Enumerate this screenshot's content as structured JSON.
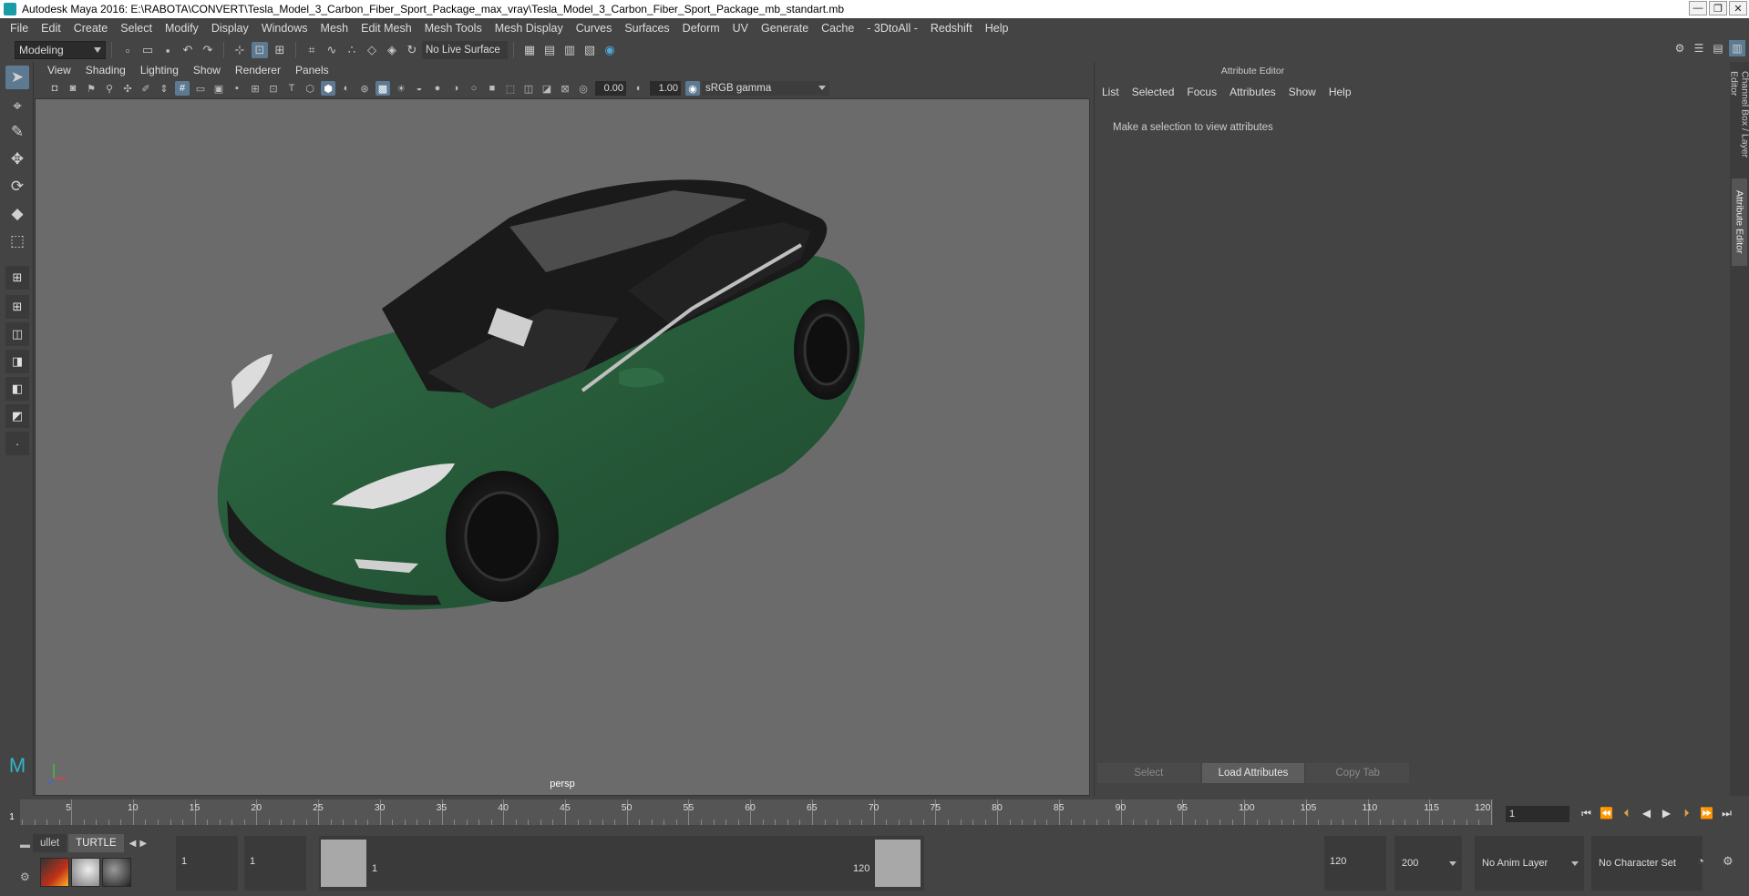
{
  "window": {
    "title": "Autodesk Maya 2016: E:\\RABOTA\\CONVERT\\Tesla_Model_3_Carbon_Fiber_Sport_Package_max_vray\\Tesla_Model_3_Carbon_Fiber_Sport_Package_mb_standart.mb",
    "minimize": "—",
    "restore": "❐",
    "close": "✕"
  },
  "menubar": [
    "File",
    "Edit",
    "Create",
    "Select",
    "Modify",
    "Display",
    "Windows",
    "Mesh",
    "Edit Mesh",
    "Mesh Tools",
    "Mesh Display",
    "Curves",
    "Surfaces",
    "Deform",
    "UV",
    "Generate",
    "Cache",
    "- 3DtoAll -",
    "Redshift",
    "Help"
  ],
  "statusline": {
    "mode": "Modeling",
    "live_surface": "No Live Surface"
  },
  "viewport": {
    "menu": [
      "View",
      "Shading",
      "Lighting",
      "Show",
      "Renderer",
      "Panels"
    ],
    "exposure": "0.00",
    "gamma": "1.00",
    "color_space": "sRGB gamma",
    "camera_label": "persp"
  },
  "attribute_editor": {
    "title": "Attribute Editor",
    "menu": [
      "List",
      "Selected",
      "Focus",
      "Attributes",
      "Show",
      "Help"
    ],
    "message": "Make a selection to view attributes",
    "buttons": {
      "select": "Select",
      "load": "Load Attributes",
      "copy": "Copy Tab"
    }
  },
  "side_tabs": {
    "channel_box": "Channel Box / Layer Editor",
    "attribute_editor": "Attribute Editor"
  },
  "timeslider": {
    "ticks": [
      "5",
      "10",
      "15",
      "20",
      "25",
      "30",
      "35",
      "40",
      "45",
      "50",
      "55",
      "60",
      "65",
      "70",
      "75",
      "80",
      "85",
      "90",
      "95",
      "100",
      "105",
      "110",
      "115",
      "120"
    ],
    "current_marker": "1",
    "current_frame": "1"
  },
  "shelf": {
    "tabs": [
      "ullet",
      "TURTLE"
    ]
  },
  "range": {
    "start": "1",
    "playback_start": "1",
    "handle_start": "1",
    "handle_end": "120",
    "playback_end": "120",
    "end": "200",
    "anim_layer": "No Anim Layer",
    "character_set": "No Character Set"
  },
  "colors": {
    "car_body": "#2a5c3a",
    "viewport_bg": "#6b6b6b",
    "accent": "#5d7a92"
  }
}
